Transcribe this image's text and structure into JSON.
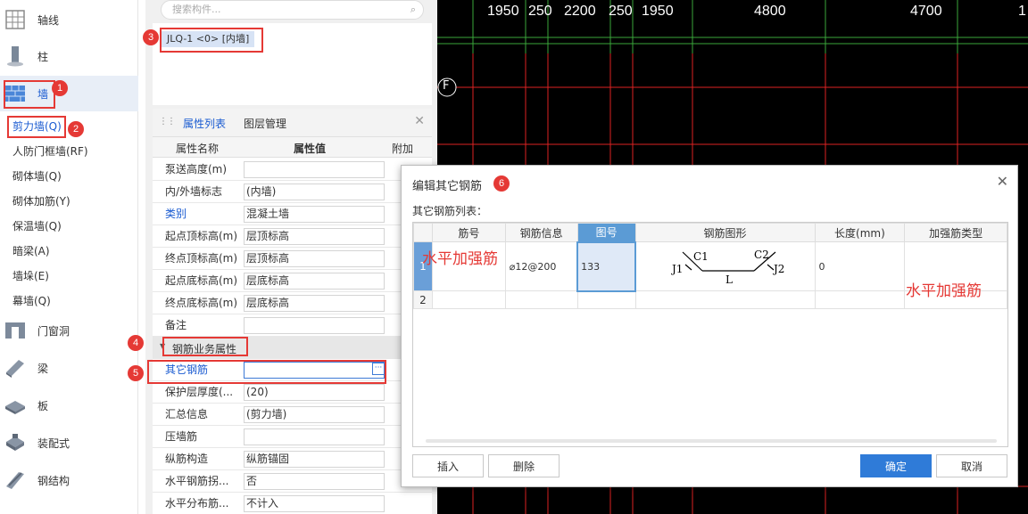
{
  "tree": {
    "items": [
      {
        "label": "轴线",
        "icon": "grid-axis-icon"
      },
      {
        "label": "柱",
        "icon": "column-icon"
      },
      {
        "label": "墙",
        "icon": "wall-brick-icon"
      },
      {
        "label": "门窗洞",
        "icon": "door-window-icon"
      },
      {
        "label": "梁",
        "icon": "beam-icon"
      },
      {
        "label": "板",
        "icon": "slab-icon"
      },
      {
        "label": "装配式",
        "icon": "prefab-icon"
      },
      {
        "label": "钢结构",
        "icon": "steel-structure-icon"
      }
    ],
    "wall_subitems": [
      "剪力墙(Q)",
      "人防门框墙(RF)",
      "砌体墙(Q)",
      "砌体加筋(Y)",
      "保温墙(Q)",
      "暗梁(A)",
      "墙垛(E)",
      "幕墙(Q)"
    ]
  },
  "search": {
    "placeholder": "搜索构件..."
  },
  "component": {
    "name": "JLQ-1 <0> [内墙]"
  },
  "props_panel": {
    "tab_properties": "属性列表",
    "tab_layers": "图层管理",
    "col_name": "属性名称",
    "col_value": "属性值",
    "col_extra": "附加",
    "rows": [
      {
        "name": "泵送高度(m)",
        "value": ""
      },
      {
        "name": "内/外墙标志",
        "value": "(内墙)"
      },
      {
        "name": "类别",
        "value": "混凝土墙"
      },
      {
        "name": "起点顶标高(m)",
        "value": "层顶标高"
      },
      {
        "name": "终点顶标高(m)",
        "value": "层顶标高"
      },
      {
        "name": "起点底标高(m)",
        "value": "层底标高"
      },
      {
        "name": "终点底标高(m)",
        "value": "层底标高"
      },
      {
        "name": "备注",
        "value": ""
      }
    ],
    "group_label": "钢筋业务属性",
    "rebar_rows": [
      {
        "name": "其它钢筋",
        "value": ""
      },
      {
        "name": "保护层厚度(...",
        "value": "(20)"
      },
      {
        "name": "汇总信息",
        "value": "(剪力墙)"
      },
      {
        "name": "压墙筋",
        "value": ""
      },
      {
        "name": "纵筋构造",
        "value": "纵筋锚固"
      },
      {
        "name": "水平钢筋拐...",
        "value": "否"
      },
      {
        "name": "水平分布筋...",
        "value": "不计入"
      }
    ],
    "ellipsis": "···"
  },
  "cad": {
    "dimensions": [
      "1950",
      "250",
      "2200",
      "250",
      "1950",
      "4800",
      "4700",
      "1"
    ],
    "axis_label": "F"
  },
  "badges": [
    "1",
    "2",
    "3",
    "4",
    "5",
    "6"
  ],
  "dialog": {
    "title": "编辑其它钢筋",
    "subtitle": "其它钢筋列表：",
    "columns": [
      "筋号",
      "钢筋信息",
      "图号",
      "钢筋图形",
      "长度(mm)",
      "加强筋类型"
    ],
    "rows": [
      {
        "num": "1",
        "name": "水平加强筋",
        "info": "⌀12@200",
        "figure": "133",
        "length": "0",
        "type": "水平加强筋"
      },
      {
        "num": "2",
        "name": "",
        "info": "",
        "figure": "",
        "length": "",
        "type": ""
      }
    ],
    "shape_labels": {
      "c1": "C1",
      "c2": "C2",
      "j1": "J1",
      "j2": "J2",
      "l": "L"
    },
    "btn_insert": "插入",
    "btn_delete": "删除",
    "btn_ok": "确定",
    "btn_cancel": "取消"
  }
}
